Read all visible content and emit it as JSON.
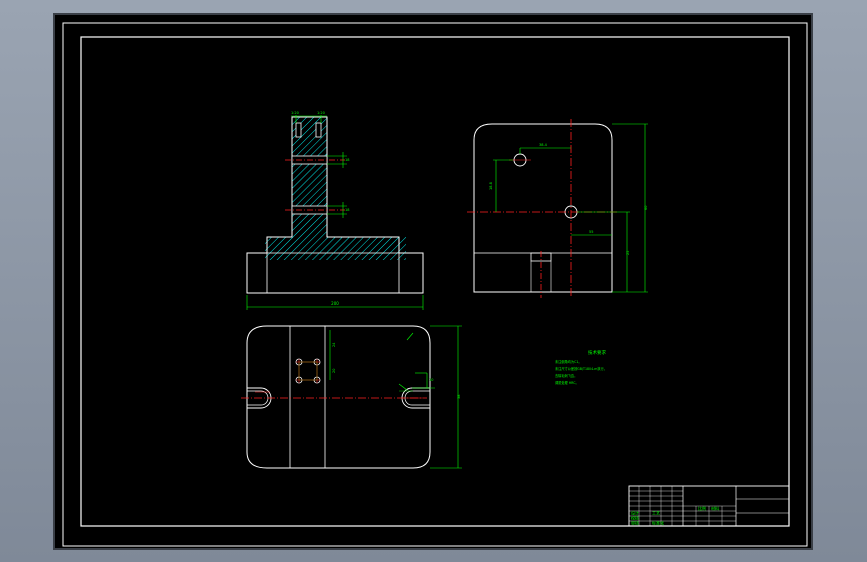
{
  "colors": {
    "background": "#000000",
    "outline": "#ffffff",
    "dimension": "#00ff00",
    "centerline": "#ff2020",
    "hatch": "#00e5e5"
  },
  "drawing": {
    "front_view": {
      "width_dim": "200",
      "top_dims": [
        "1:20",
        "1:20"
      ],
      "side_dims": [
        "18",
        "18"
      ]
    },
    "side_view": {
      "dims": [
        "38.4",
        "18.8",
        "55",
        "25",
        "60"
      ]
    },
    "top_view": {
      "dims": [
        "20",
        "24",
        "10",
        "38"
      ]
    },
    "notes": {
      "title": "技术要求",
      "lines": [
        "未注倒角均为C1。",
        "未注尺寸公差按GB/T1804-m执行。",
        "去除毛刺飞边。",
        "调质处理 HRC。"
      ]
    },
    "title_block": {
      "fields": [
        "设计",
        "校核",
        "审核",
        "工艺",
        "标准化",
        "比例",
        "材料"
      ]
    }
  }
}
